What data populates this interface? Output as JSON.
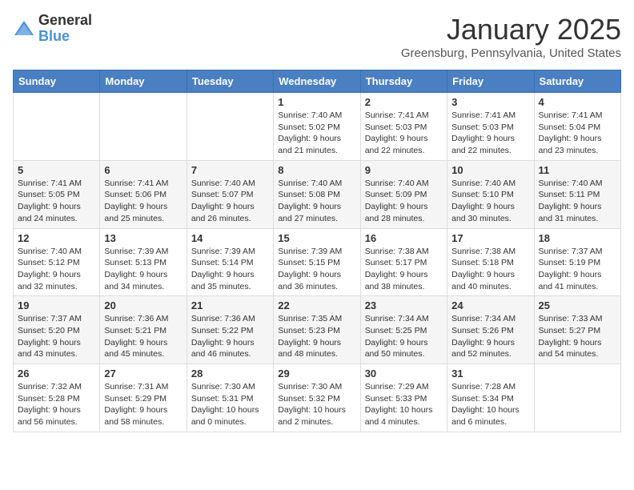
{
  "logo": {
    "general": "General",
    "blue": "Blue"
  },
  "title": "January 2025",
  "location": "Greensburg, Pennsylvania, United States",
  "weekdays": [
    "Sunday",
    "Monday",
    "Tuesday",
    "Wednesday",
    "Thursday",
    "Friday",
    "Saturday"
  ],
  "weeks": [
    [
      {
        "day": "",
        "info": ""
      },
      {
        "day": "",
        "info": ""
      },
      {
        "day": "",
        "info": ""
      },
      {
        "day": "1",
        "info": "Sunrise: 7:40 AM\nSunset: 5:02 PM\nDaylight: 9 hours and 21 minutes."
      },
      {
        "day": "2",
        "info": "Sunrise: 7:41 AM\nSunset: 5:03 PM\nDaylight: 9 hours and 22 minutes."
      },
      {
        "day": "3",
        "info": "Sunrise: 7:41 AM\nSunset: 5:03 PM\nDaylight: 9 hours and 22 minutes."
      },
      {
        "day": "4",
        "info": "Sunrise: 7:41 AM\nSunset: 5:04 PM\nDaylight: 9 hours and 23 minutes."
      }
    ],
    [
      {
        "day": "5",
        "info": "Sunrise: 7:41 AM\nSunset: 5:05 PM\nDaylight: 9 hours and 24 minutes."
      },
      {
        "day": "6",
        "info": "Sunrise: 7:41 AM\nSunset: 5:06 PM\nDaylight: 9 hours and 25 minutes."
      },
      {
        "day": "7",
        "info": "Sunrise: 7:40 AM\nSunset: 5:07 PM\nDaylight: 9 hours and 26 minutes."
      },
      {
        "day": "8",
        "info": "Sunrise: 7:40 AM\nSunset: 5:08 PM\nDaylight: 9 hours and 27 minutes."
      },
      {
        "day": "9",
        "info": "Sunrise: 7:40 AM\nSunset: 5:09 PM\nDaylight: 9 hours and 28 minutes."
      },
      {
        "day": "10",
        "info": "Sunrise: 7:40 AM\nSunset: 5:10 PM\nDaylight: 9 hours and 30 minutes."
      },
      {
        "day": "11",
        "info": "Sunrise: 7:40 AM\nSunset: 5:11 PM\nDaylight: 9 hours and 31 minutes."
      }
    ],
    [
      {
        "day": "12",
        "info": "Sunrise: 7:40 AM\nSunset: 5:12 PM\nDaylight: 9 hours and 32 minutes."
      },
      {
        "day": "13",
        "info": "Sunrise: 7:39 AM\nSunset: 5:13 PM\nDaylight: 9 hours and 34 minutes."
      },
      {
        "day": "14",
        "info": "Sunrise: 7:39 AM\nSunset: 5:14 PM\nDaylight: 9 hours and 35 minutes."
      },
      {
        "day": "15",
        "info": "Sunrise: 7:39 AM\nSunset: 5:15 PM\nDaylight: 9 hours and 36 minutes."
      },
      {
        "day": "16",
        "info": "Sunrise: 7:38 AM\nSunset: 5:17 PM\nDaylight: 9 hours and 38 minutes."
      },
      {
        "day": "17",
        "info": "Sunrise: 7:38 AM\nSunset: 5:18 PM\nDaylight: 9 hours and 40 minutes."
      },
      {
        "day": "18",
        "info": "Sunrise: 7:37 AM\nSunset: 5:19 PM\nDaylight: 9 hours and 41 minutes."
      }
    ],
    [
      {
        "day": "19",
        "info": "Sunrise: 7:37 AM\nSunset: 5:20 PM\nDaylight: 9 hours and 43 minutes."
      },
      {
        "day": "20",
        "info": "Sunrise: 7:36 AM\nSunset: 5:21 PM\nDaylight: 9 hours and 45 minutes."
      },
      {
        "day": "21",
        "info": "Sunrise: 7:36 AM\nSunset: 5:22 PM\nDaylight: 9 hours and 46 minutes."
      },
      {
        "day": "22",
        "info": "Sunrise: 7:35 AM\nSunset: 5:23 PM\nDaylight: 9 hours and 48 minutes."
      },
      {
        "day": "23",
        "info": "Sunrise: 7:34 AM\nSunset: 5:25 PM\nDaylight: 9 hours and 50 minutes."
      },
      {
        "day": "24",
        "info": "Sunrise: 7:34 AM\nSunset: 5:26 PM\nDaylight: 9 hours and 52 minutes."
      },
      {
        "day": "25",
        "info": "Sunrise: 7:33 AM\nSunset: 5:27 PM\nDaylight: 9 hours and 54 minutes."
      }
    ],
    [
      {
        "day": "26",
        "info": "Sunrise: 7:32 AM\nSunset: 5:28 PM\nDaylight: 9 hours and 56 minutes."
      },
      {
        "day": "27",
        "info": "Sunrise: 7:31 AM\nSunset: 5:29 PM\nDaylight: 9 hours and 58 minutes."
      },
      {
        "day": "28",
        "info": "Sunrise: 7:30 AM\nSunset: 5:31 PM\nDaylight: 10 hours and 0 minutes."
      },
      {
        "day": "29",
        "info": "Sunrise: 7:30 AM\nSunset: 5:32 PM\nDaylight: 10 hours and 2 minutes."
      },
      {
        "day": "30",
        "info": "Sunrise: 7:29 AM\nSunset: 5:33 PM\nDaylight: 10 hours and 4 minutes."
      },
      {
        "day": "31",
        "info": "Sunrise: 7:28 AM\nSunset: 5:34 PM\nDaylight: 10 hours and 6 minutes."
      },
      {
        "day": "",
        "info": ""
      }
    ]
  ]
}
